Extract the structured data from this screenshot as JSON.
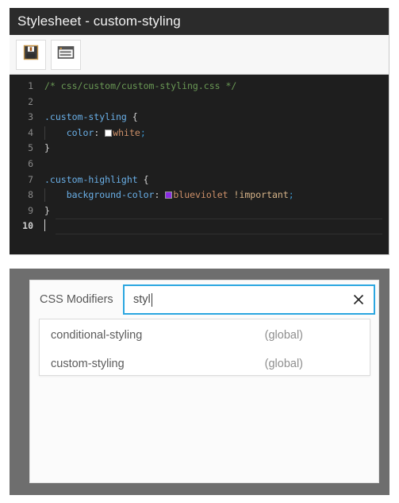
{
  "editor": {
    "title": "Stylesheet - custom-styling",
    "toolbar": {
      "save_label": "save-icon",
      "properties_label": "form-window-icon"
    },
    "code_lines": [
      {
        "number": "1",
        "segments": [
          {
            "text": "/* css/custom/custom-styling.css */",
            "type": "comment"
          }
        ]
      },
      {
        "number": "2",
        "segments": []
      },
      {
        "number": "3",
        "segments": [
          {
            "text": ".custom-styling",
            "type": "selector"
          },
          {
            "text": " {",
            "type": "punct"
          }
        ]
      },
      {
        "number": "4",
        "segments": [
          {
            "text": "    ",
            "type": "punct"
          },
          {
            "text": "color",
            "type": "prop"
          },
          {
            "text": ": ",
            "type": "punct"
          },
          {
            "text": "white",
            "type": "value",
            "swatch": "#ffffff"
          },
          {
            "text": ";",
            "type": "semi"
          }
        ],
        "indent": true
      },
      {
        "number": "5",
        "segments": [
          {
            "text": "}",
            "type": "punct"
          }
        ]
      },
      {
        "number": "6",
        "segments": []
      },
      {
        "number": "7",
        "segments": [
          {
            "text": ".custom-highlight",
            "type": "selector"
          },
          {
            "text": " {",
            "type": "punct"
          }
        ]
      },
      {
        "number": "8",
        "segments": [
          {
            "text": "    ",
            "type": "punct"
          },
          {
            "text": "background-color",
            "type": "prop"
          },
          {
            "text": ": ",
            "type": "punct"
          },
          {
            "text": "blueviolet",
            "type": "value",
            "swatch": "#8a2be2"
          },
          {
            "text": " ",
            "type": "punct"
          },
          {
            "text": "!important",
            "type": "imp"
          },
          {
            "text": ";",
            "type": "semi"
          }
        ],
        "indent": true
      },
      {
        "number": "9",
        "segments": [
          {
            "text": "}",
            "type": "punct"
          }
        ]
      },
      {
        "number": "10",
        "segments": [],
        "active": true,
        "caret": true
      }
    ]
  },
  "modifier_panel": {
    "label": "CSS Modifiers",
    "search": {
      "value": "styl",
      "placeholder": "",
      "clear_icon": "close-icon"
    },
    "suggestions": [
      {
        "name": "conditional-styling",
        "scope": "(global)"
      },
      {
        "name": "custom-styling",
        "scope": "(global)"
      }
    ]
  },
  "colors": {
    "titlebar_bg": "#2b2b2b",
    "editor_bg": "#1e1e1e",
    "panel_bg": "#6e6e6e",
    "focus_border": "#2ba6e0",
    "comment": "#6a9955",
    "selector": "#6ab0e8",
    "value": "#cd9069"
  }
}
